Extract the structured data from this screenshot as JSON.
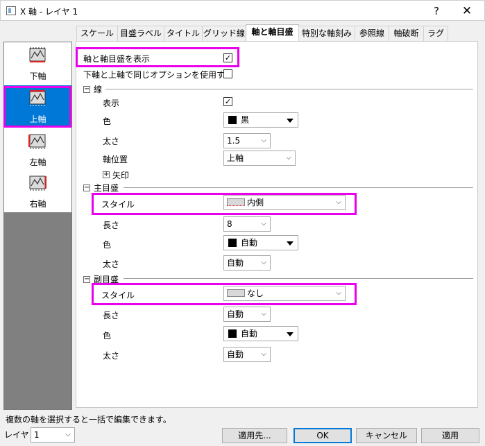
{
  "window": {
    "title": "X 軸 - レイヤ 1",
    "help": "?",
    "close": "✕"
  },
  "left_list": [
    {
      "label": "下軸",
      "icon": "bottom-axis-icon",
      "selected": false
    },
    {
      "label": "上軸",
      "icon": "top-axis-icon",
      "selected": true
    },
    {
      "label": "左軸",
      "icon": "left-axis-icon",
      "selected": false
    },
    {
      "label": "右軸",
      "icon": "right-axis-icon",
      "selected": false
    }
  ],
  "tabs": [
    "スケール",
    "目盛ラベル",
    "タイトル",
    "グリッド線",
    "軸と軸目盛",
    "特別な軸刻み",
    "参照線",
    "軸破断",
    "ラグ"
  ],
  "active_tab": "軸と軸目盛",
  "options": {
    "show_axis": {
      "label": "軸と軸目盛を表示",
      "checked": true
    },
    "same_options": {
      "label": "下軸と上軸で同じオプションを使用する",
      "checked": false
    }
  },
  "line_section": {
    "title": "線",
    "show": {
      "label": "表示",
      "checked": true
    },
    "color": {
      "label": "色",
      "value": "黒"
    },
    "thickness": {
      "label": "太さ",
      "value": "1.5"
    },
    "axis_position": {
      "label": "軸位置",
      "value": "上軸"
    },
    "arrow": {
      "label": "矢印"
    }
  },
  "major_section": {
    "title": "主目盛",
    "style": {
      "label": "スタイル",
      "value": "内側"
    },
    "length": {
      "label": "長さ",
      "value": "8"
    },
    "color": {
      "label": "色",
      "value": "自動"
    },
    "thickness": {
      "label": "太さ",
      "value": "自動"
    }
  },
  "minor_section": {
    "title": "副目盛",
    "style": {
      "label": "スタイル",
      "value": "なし"
    },
    "length": {
      "label": "長さ",
      "value": "自動"
    },
    "color": {
      "label": "色",
      "value": "自動"
    },
    "thickness": {
      "label": "太さ",
      "value": "自動"
    }
  },
  "status_text": "複数の軸を選択すると一括で編集できます。",
  "layer": {
    "label": "レイヤ",
    "value": "1"
  },
  "buttons": {
    "apply_to": "適用先...",
    "ok": "OK",
    "cancel": "キャンセル",
    "apply": "適用"
  },
  "colors": {
    "highlight": "#ea00ea",
    "selection": "#0078d7",
    "tick_red": "#e02020"
  }
}
